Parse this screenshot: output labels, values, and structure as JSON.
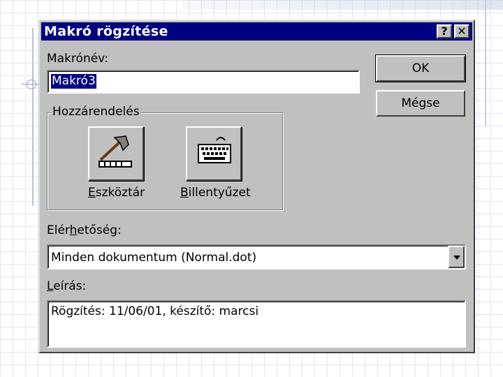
{
  "dialog": {
    "title": "Makró rögzítése",
    "help_button": "?",
    "close_button": "✕",
    "macro_name_label_pre": "Makrónév:",
    "macro_name_value": "Makró3",
    "ok_label": "OK",
    "cancel_label": "Mégse",
    "assign_group_label": "Hozzárendelés",
    "toolbar_button_label": {
      "mnemonic": "E",
      "rest": "szköztár"
    },
    "keyboard_button_label": {
      "mnemonic": "B",
      "rest": "illentyűzet"
    },
    "availability_label": {
      "pre": "Elér",
      "mnemonic": "h",
      "post": "etőség:"
    },
    "availability_value": "Minden dokumentum (Normal.dot)",
    "description_label": {
      "mnemonic": "L",
      "rest": "eírás:"
    },
    "description_value": "Rögzítés: 11/06/01, készítő: marcsi"
  },
  "colors": {
    "titlebar": "#000080",
    "dialog_face": "#c0c0c0",
    "selection": "#000080"
  },
  "icons": {
    "toolbar": "hammer-toolbar-icon",
    "keyboard": "keyboard-icon",
    "dropdown": "chevron-down-icon"
  }
}
